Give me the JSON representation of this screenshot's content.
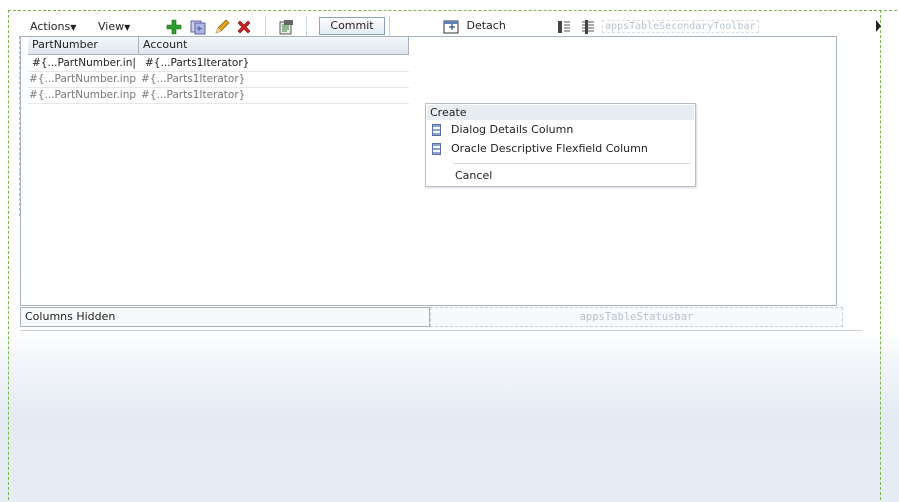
{
  "toolbar": {
    "actions_label": "Actions",
    "view_label": "View",
    "commit_label": "Commit",
    "detach_label": "Detach",
    "secondary_toolbar_label": "appsTableSecondaryToolbar",
    "icons": [
      "add-icon",
      "duplicate-icon",
      "edit-icon",
      "delete-icon",
      "export-icon",
      "detach-icon",
      "freeze-icon",
      "wrap-icon"
    ],
    "colors": {
      "add": "#2e9b2e",
      "delete": "#cc2222",
      "edit": "#e0a020"
    }
  },
  "table": {
    "columns": [
      "PartNumber",
      "Account"
    ],
    "rows": [
      [
        "#{...PartNumber.in|",
        "#{...Parts1Iterator}"
      ],
      [
        "#{...PartNumber.inp",
        "#{...Parts1Iterator}"
      ],
      [
        "#{...PartNumber.inp",
        "#{...Parts1Iterator}"
      ]
    ]
  },
  "status": {
    "columns_hidden_label": "Columns Hidden",
    "statusbar_label": "appsTableStatusbar"
  },
  "popup": {
    "header": "Create",
    "items": [
      "Dialog Details Column",
      "Oracle Descriptive Flexfield Column"
    ],
    "cancel": "Cancel"
  }
}
